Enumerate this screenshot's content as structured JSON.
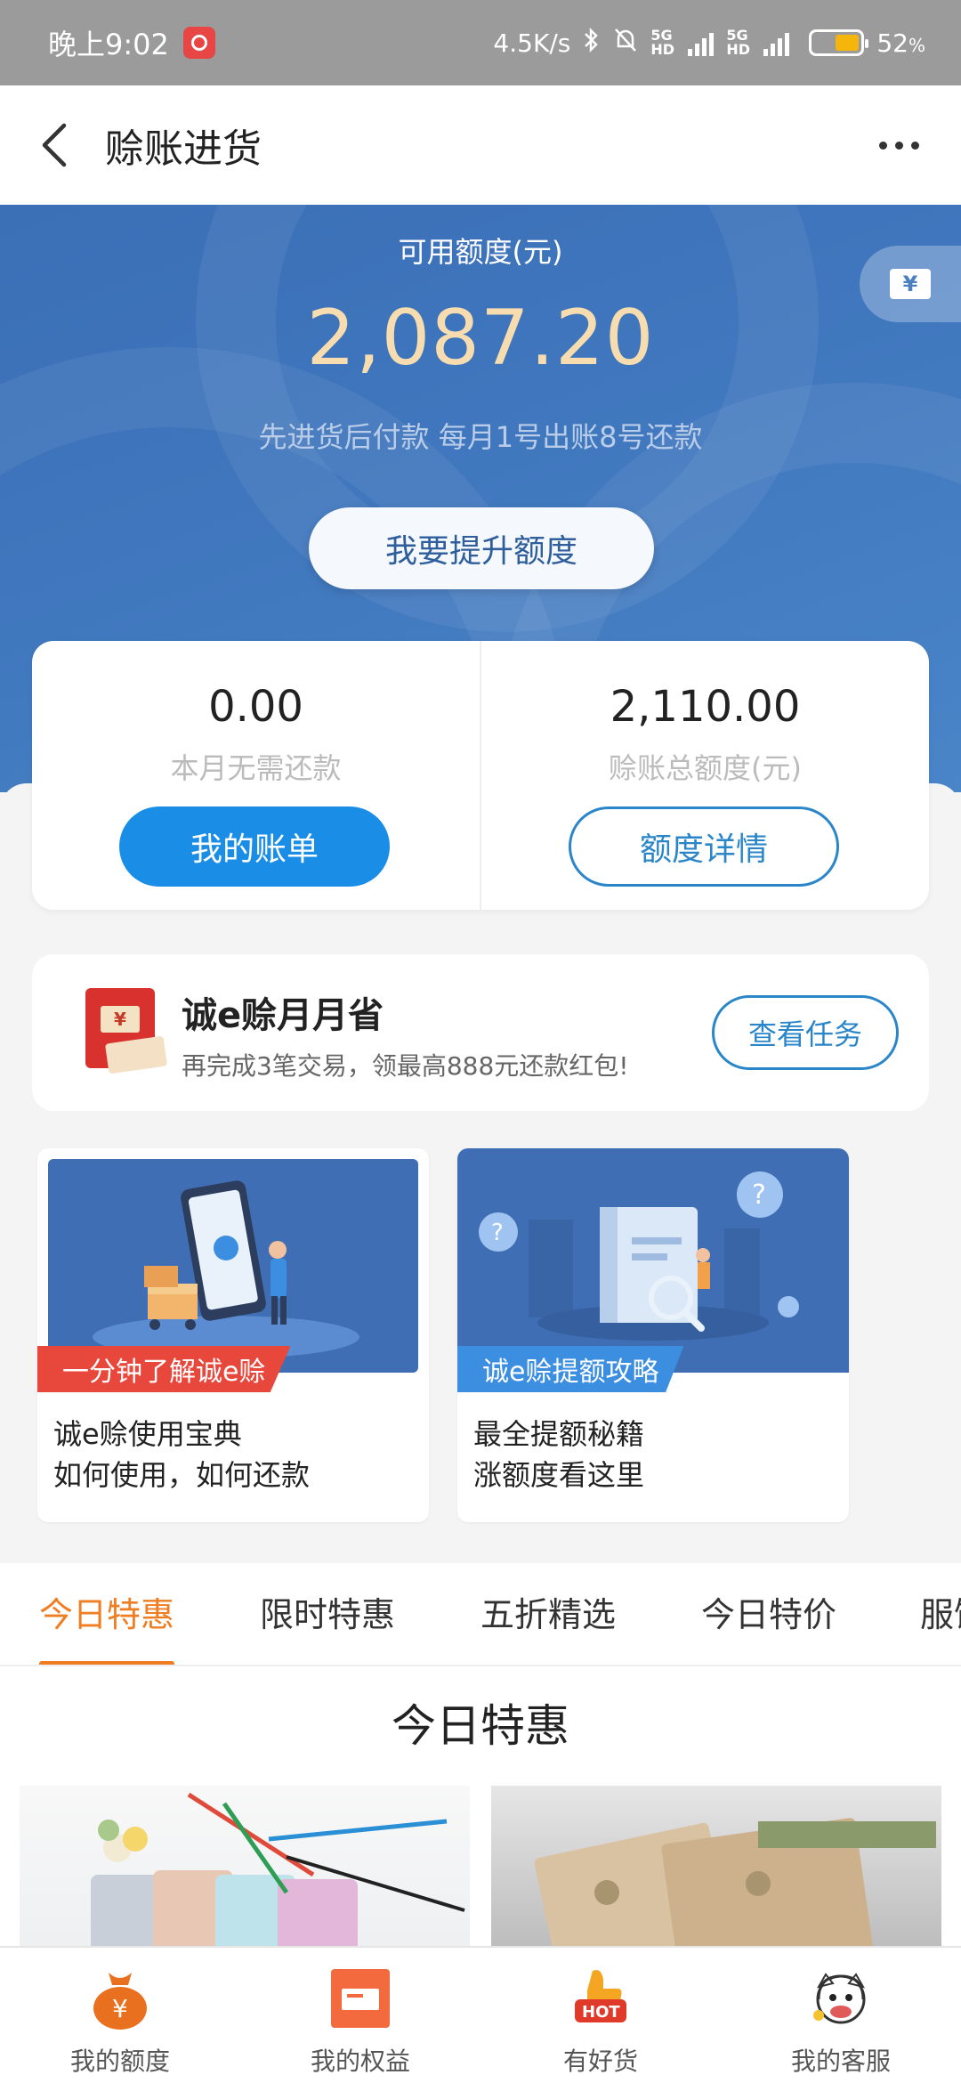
{
  "status_bar": {
    "time": "晚上9:02",
    "speed": "4.5K/s",
    "net1": "5G HD",
    "net2": "5G HD",
    "battery": "52",
    "battery_unit": "%"
  },
  "header": {
    "title": "赊账进货"
  },
  "credit": {
    "label": "可用额度(元)",
    "amount": "2,087.20",
    "note": "先进货后付款 每月1号出账8号还款",
    "raise_button": "我要提升额度"
  },
  "balance": {
    "left_value": "0.00",
    "left_label": "本月无需还款",
    "left_button": "我的账单",
    "right_value": "2,110.00",
    "right_label": "赊账总额度(元)",
    "right_button": "额度详情"
  },
  "promo": {
    "title": "诚e赊月月省",
    "subtitle": "再完成3笔交易，领最高888元还款红包!",
    "button": "查看任务",
    "icon_text": "¥"
  },
  "guides": [
    {
      "tag": "一分钟了解诚e赊",
      "line1": "诚e赊使用宝典",
      "line2": "如何使用，如何还款"
    },
    {
      "tag": "诚e赊提额攻略",
      "line1": "最全提额秘籍",
      "line2": "涨额度看这里"
    }
  ],
  "tabs": [
    "今日特惠",
    "限时特惠",
    "五折精选",
    "今日特价",
    "服饰"
  ],
  "section_title": "今日特惠",
  "bottom_nav": [
    {
      "label": "我的额度",
      "icon": "money-bag-icon"
    },
    {
      "label": "我的权益",
      "icon": "card-icon"
    },
    {
      "label": "有好货",
      "icon": "hot-thumb-icon"
    },
    {
      "label": "我的客服",
      "icon": "service-mascot-icon"
    }
  ],
  "colors": {
    "accent_orange": "#ef7d22",
    "brand_blue": "#1a8de6",
    "hero_blue": "#3f76bd",
    "amount_gold": "#f7dcb0"
  }
}
